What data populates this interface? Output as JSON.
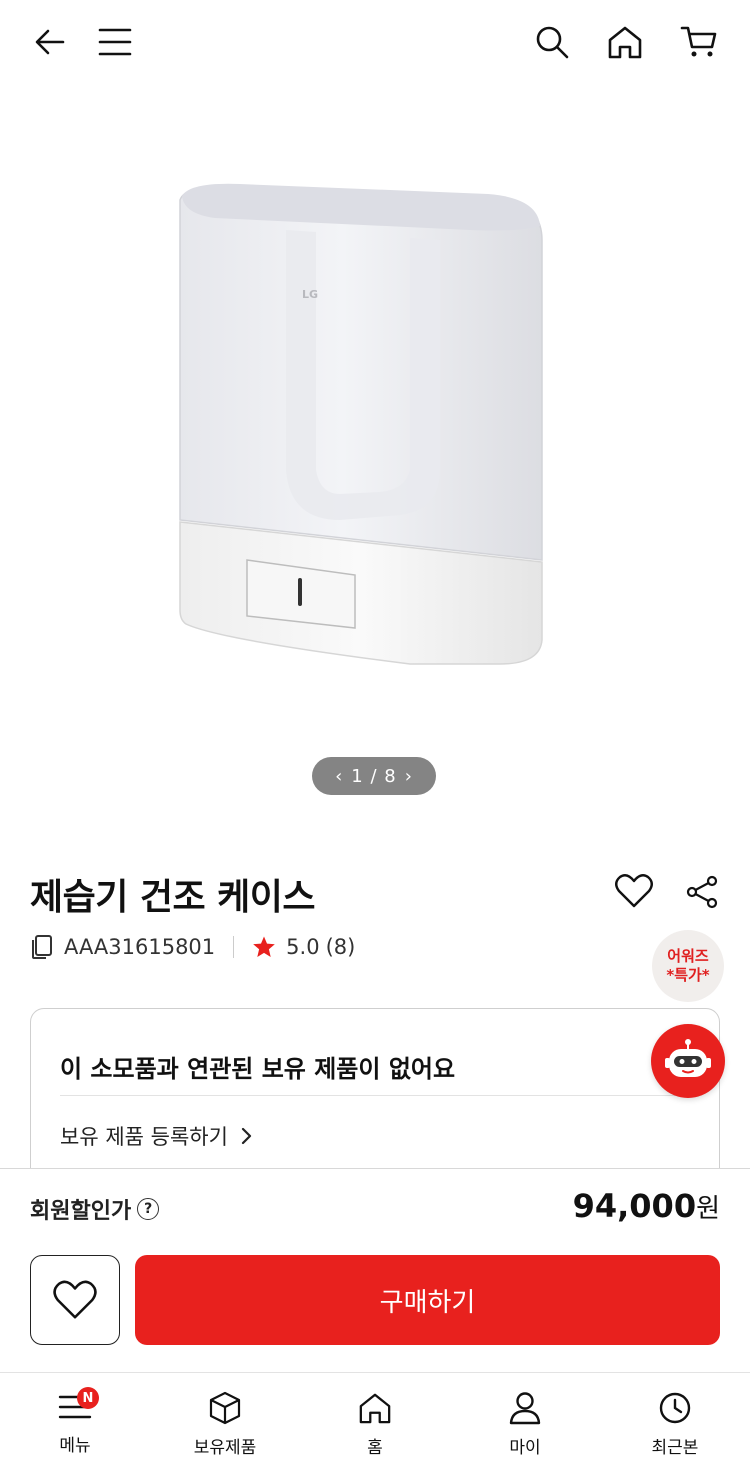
{
  "header": {
    "back_icon": "arrow-left-icon",
    "menu_icon": "hamburger-icon",
    "search_icon": "search-icon",
    "home_icon": "home-icon",
    "cart_icon": "cart-icon"
  },
  "gallery": {
    "current": "1",
    "total": "8",
    "separator": " / ",
    "product_logo": "LG"
  },
  "product": {
    "title": "제습기 건조 케이스",
    "model": "AAA31615801",
    "rating": "5.0",
    "review_count": "(8)"
  },
  "event_badge": {
    "line1": "어워즈",
    "line2": "*특가*"
  },
  "owned_card": {
    "headline": "이 소모품과 연관된 보유 제품이 없어요",
    "register_label": "보유 제품 등록하기"
  },
  "purchase": {
    "price_label": "회원할인가",
    "price": "94,000",
    "currency": "원",
    "buy_label": "구매하기"
  },
  "tabbar": {
    "tabs": [
      {
        "label": "메뉴",
        "icon": "menu-icon",
        "badge": "N"
      },
      {
        "label": "보유제품",
        "icon": "box-icon"
      },
      {
        "label": "홈",
        "icon": "home-icon"
      },
      {
        "label": "마이",
        "icon": "person-icon"
      },
      {
        "label": "최근본",
        "icon": "clock-icon"
      }
    ]
  },
  "colors": {
    "accent": "#e8211e",
    "text": "#111111",
    "pager_bg": "#6e6e6e"
  }
}
